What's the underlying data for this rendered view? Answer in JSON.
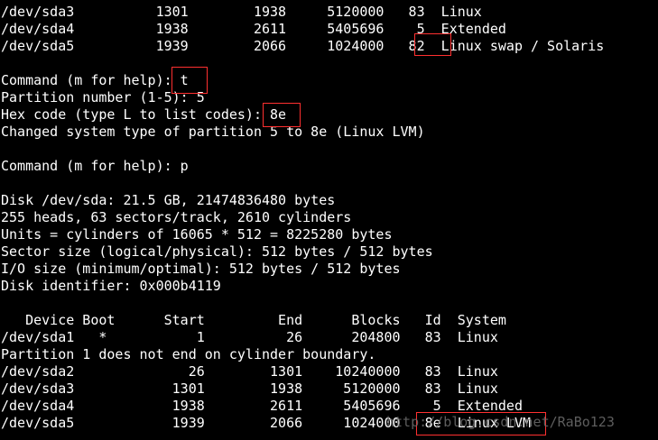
{
  "terminal": {
    "lines": [
      "/dev/sda3          1301        1938     5120000   83  Linux",
      "/dev/sda4          1938        2611     5405696    5  Extended",
      "/dev/sda5          1939        2066     1024000   82  Linux swap / Solaris",
      "",
      "Command (m for help): t",
      "Partition number (1-5): 5",
      "Hex code (type L to list codes): 8e",
      "Changed system type of partition 5 to 8e (Linux LVM)",
      "",
      "Command (m for help): p",
      "",
      "Disk /dev/sda: 21.5 GB, 21474836480 bytes",
      "255 heads, 63 sectors/track, 2610 cylinders",
      "Units = cylinders of 16065 * 512 = 8225280 bytes",
      "Sector size (logical/physical): 512 bytes / 512 bytes",
      "I/O size (minimum/optimal): 512 bytes / 512 bytes",
      "Disk identifier: 0x000b4119",
      "",
      "   Device Boot      Start         End      Blocks   Id  System",
      "/dev/sda1   *           1          26      204800   83  Linux",
      "Partition 1 does not end on cylinder boundary.",
      "/dev/sda2              26        1301    10240000   83  Linux",
      "/dev/sda3            1301        1938     5120000   83  Linux",
      "/dev/sda4            1938        2611     5405696    5  Extended",
      "/dev/sda5            1939        2066     1024000   8e  Linux LVM"
    ],
    "watermark": "http://blog.csdn.net/RaBo123"
  },
  "colors": {
    "background": "#000000",
    "text": "#ffffff",
    "highlight_box": "#ff3030",
    "watermark": "#6e6e6e"
  }
}
